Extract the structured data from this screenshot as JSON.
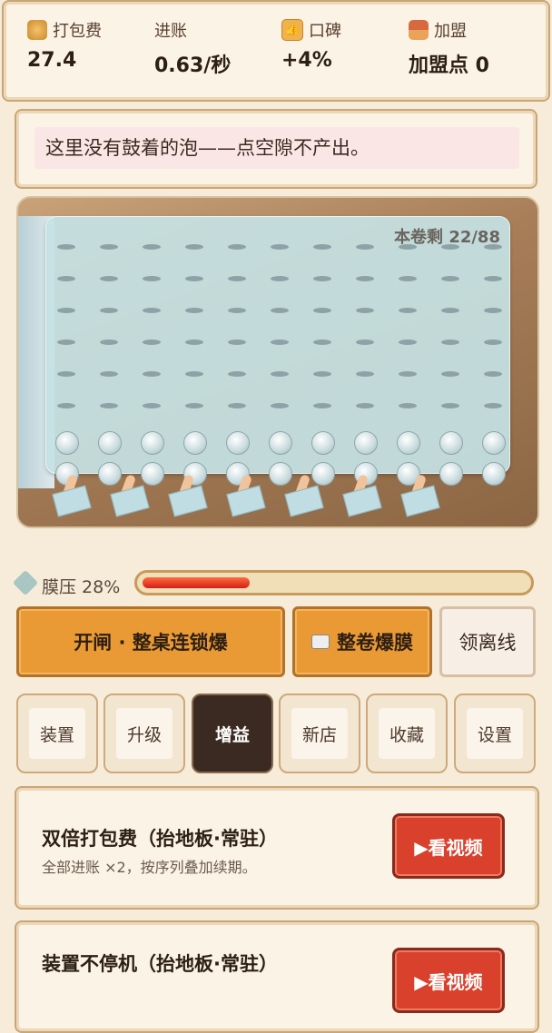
{
  "stats": [
    {
      "label": "打包费",
      "value": "27.4",
      "icon": "coin-stack-icon",
      "icon_color": "#e0a040"
    },
    {
      "label": "进账",
      "value": "0.63/秒"
    },
    {
      "label": "口碑",
      "value": "+4%",
      "icon": "thumbs-up-icon",
      "icon_color": "#e8a13a"
    },
    {
      "label": "加盟",
      "value": "加盟点 0",
      "icon": "gift-box-icon",
      "icon_color": "#c8653b"
    }
  ],
  "message": "这里没有鼓着的泡——点空隙不产出。",
  "roll_remaining": "本卷剩 22/88",
  "pressure": {
    "label": "膜压 28%",
    "percent": 28
  },
  "actions": {
    "chain": "开闸 · 整桌连锁爆",
    "roll": "整卷爆膜",
    "offline": "领离线"
  },
  "tabs": [
    "装置",
    "升级",
    "增益",
    "新店",
    "收藏",
    "设置"
  ],
  "active_tab": "增益",
  "boosts": [
    {
      "title": "双倍打包费（抬地板·常驻）",
      "desc": "全部进账 ×2，按序列叠加续期。",
      "button": "▶看视频"
    },
    {
      "title": "装置不停机（抬地板·常驻）",
      "desc": "",
      "button": "▶看视频"
    }
  ]
}
